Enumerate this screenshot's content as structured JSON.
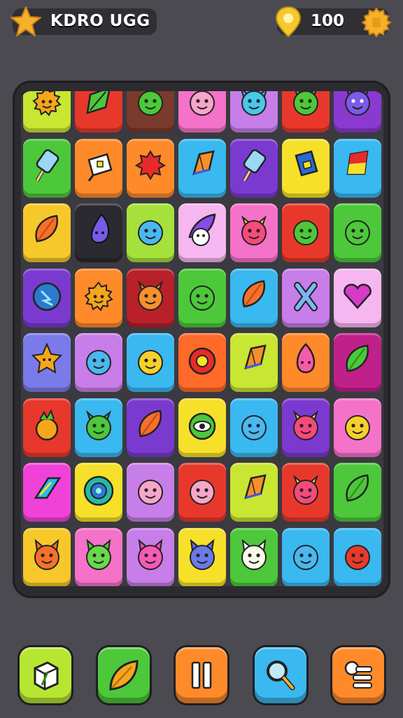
{
  "header": {
    "title": "KDRO UGG",
    "coins": "100"
  },
  "board": {
    "rows": 8,
    "cols": 7,
    "tiles": [
      {
        "color": "#c8e632",
        "icon": "sun-face"
      },
      {
        "color": "#e8382c",
        "icon": "leaf"
      },
      {
        "color": "#7a3a2c",
        "icon": "green-blob"
      },
      {
        "color": "#f472c8",
        "icon": "pink-face"
      },
      {
        "color": "#c77ee8",
        "icon": "cyan-creature"
      },
      {
        "color": "#e8382c",
        "icon": "green-creature"
      },
      {
        "color": "#8a3ad0",
        "icon": "purple-creature"
      },
      {
        "color": "#4cc83a",
        "icon": "popsicle"
      },
      {
        "color": "#ff8a2a",
        "icon": "gift-bag"
      },
      {
        "color": "#ff8a2a",
        "icon": "red-flower"
      },
      {
        "color": "#3ab8f0",
        "icon": "diamond-kite"
      },
      {
        "color": "#7a3ad0",
        "icon": "popsicle"
      },
      {
        "color": "#f6e02a",
        "icon": "book"
      },
      {
        "color": "#3ab8f0",
        "icon": "flag"
      },
      {
        "color": "#f6c82a",
        "icon": "orange-leaf"
      },
      {
        "color": "#2a2a30",
        "icon": "purple-drop"
      },
      {
        "color": "#a6e03a",
        "icon": "blue-blob"
      },
      {
        "color": "#f6b6f0",
        "icon": "wizard"
      },
      {
        "color": "#f472c8",
        "icon": "pink-creature"
      },
      {
        "color": "#e8382c",
        "icon": "green-blob"
      },
      {
        "color": "#4cc83a",
        "icon": "green-blob"
      },
      {
        "color": "#7a3ad0",
        "icon": "blue-ball"
      },
      {
        "color": "#ff8a2a",
        "icon": "sun-face"
      },
      {
        "color": "#b8202a",
        "icon": "orange-creature"
      },
      {
        "color": "#4cc83a",
        "icon": "green-blob"
      },
      {
        "color": "#3ab8f0",
        "icon": "orange-leaf"
      },
      {
        "color": "#c77ee8",
        "icon": "bone-x"
      },
      {
        "color": "#f6b6f0",
        "icon": "pink-heart"
      },
      {
        "color": "#7a7ae8",
        "icon": "star-face"
      },
      {
        "color": "#c77ee8",
        "icon": "blue-blob"
      },
      {
        "color": "#3ab8f0",
        "icon": "yellow-blob"
      },
      {
        "color": "#ff6a2a",
        "icon": "red-ring"
      },
      {
        "color": "#c8e632",
        "icon": "diamond-kite"
      },
      {
        "color": "#ff8a2a",
        "icon": "pink-drop"
      },
      {
        "color": "#c0208a",
        "icon": "green-leaf"
      },
      {
        "color": "#e8382c",
        "icon": "fruit"
      },
      {
        "color": "#3ab8f0",
        "icon": "green-creature"
      },
      {
        "color": "#7a3ad0",
        "icon": "orange-leaf"
      },
      {
        "color": "#f6e02a",
        "icon": "green-eye"
      },
      {
        "color": "#3ab8f0",
        "icon": "blue-blob"
      },
      {
        "color": "#7a3ad0",
        "icon": "pink-creature"
      },
      {
        "color": "#f472c8",
        "icon": "yellow-blob"
      },
      {
        "color": "#f042d8",
        "icon": "chevron"
      },
      {
        "color": "#f6e02a",
        "icon": "blue-ring"
      },
      {
        "color": "#c77ee8",
        "icon": "pink-face"
      },
      {
        "color": "#e8382c",
        "icon": "pink-face"
      },
      {
        "color": "#c8e632",
        "icon": "diamond-kite"
      },
      {
        "color": "#e8382c",
        "icon": "pink-creature"
      },
      {
        "color": "#4cc83a",
        "icon": "green-leaf"
      },
      {
        "color": "#f6c82a",
        "icon": "cat"
      },
      {
        "color": "#f472c8",
        "icon": "green-cat"
      },
      {
        "color": "#c77ee8",
        "icon": "pink-cat"
      },
      {
        "color": "#f6e02a",
        "icon": "blue-cat"
      },
      {
        "color": "#4cc83a",
        "icon": "white-cat"
      },
      {
        "color": "#3ab8f0",
        "icon": "blue-blob"
      },
      {
        "color": "#3ab8f0",
        "icon": "red-blob"
      }
    ]
  },
  "toolbar": {
    "buttons": [
      {
        "name": "cube-tool-button",
        "icon": "cube-icon",
        "color": "#b6e632"
      },
      {
        "name": "leaf-tool-button",
        "icon": "leaf-icon",
        "color": "#4cc83a"
      },
      {
        "name": "pause-button",
        "icon": "pause-icon",
        "color": "#ff8a2a"
      },
      {
        "name": "search-button",
        "icon": "search-icon",
        "color": "#3ab8f0"
      },
      {
        "name": "menu-button",
        "icon": "list-icon",
        "color": "#ff8a2a"
      }
    ]
  }
}
